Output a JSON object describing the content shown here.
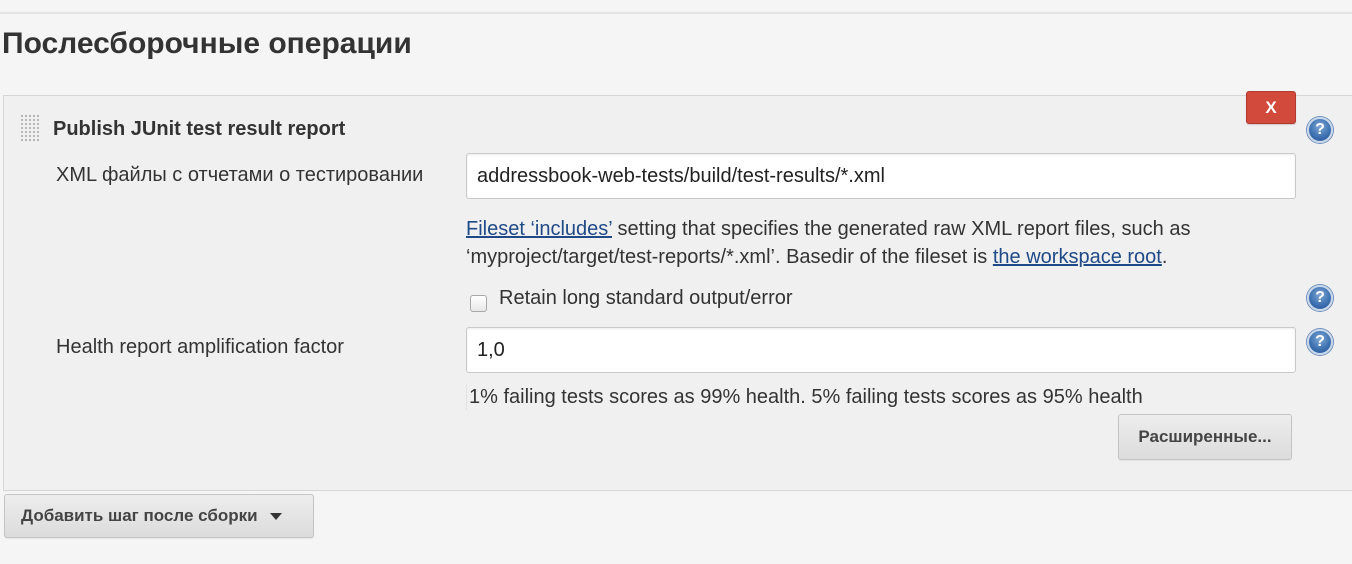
{
  "section": {
    "title": "Послесборочные операции"
  },
  "step": {
    "title": "Publish JUnit test result report",
    "delete_label": "X",
    "help_glyph": "?",
    "xml_files": {
      "label": "XML файлы с отчетами о тестировании",
      "value": "addressbook-web-tests/build/test-results/*.xml",
      "help": {
        "link1": "Fileset ‘includes’",
        "text1": " setting that specifies the generated raw XML report files, such as ‘myproject/target/test-reports/*.xml’. Basedir of the fileset is ",
        "link2": "the workspace root",
        "text2": "."
      }
    },
    "retain_output": {
      "label": "Retain long standard output/error",
      "checked": false
    },
    "health_factor": {
      "label": "Health report amplification factor",
      "value": "1,0",
      "hint": "1% failing tests scores as 99% health. 5% failing tests scores as 95% health"
    },
    "advanced_label": "Расширенные..."
  },
  "add_step": {
    "label": "Добавить шаг после сборки"
  },
  "colors": {
    "delete_button": "#d24a3b",
    "link": "#204a87",
    "help_icon": "#3b6fb0"
  },
  "icons": [
    "drag-handle-icon",
    "help-icon",
    "chevron-down-icon"
  ]
}
